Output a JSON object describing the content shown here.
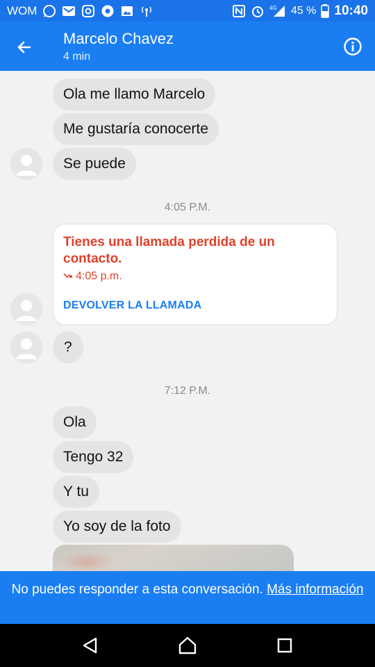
{
  "status_bar": {
    "carrier": "WOM",
    "network": "4G",
    "battery": "45 %",
    "time": "10:40",
    "left_icons": [
      "whatsapp-icon",
      "mail-icon",
      "instagram-icon",
      "chrome-icon",
      "gallery-icon",
      "signal-broadcast-icon"
    ],
    "right_icons": [
      "nfc-icon",
      "alarm-icon",
      "cell-signal-icon",
      "battery-icon"
    ]
  },
  "header": {
    "contact_name": "Marcelo Chavez",
    "subtitle": "4 min",
    "back_icon": "arrow-left-icon",
    "info_icon": "info-icon"
  },
  "thread": {
    "group1": [
      "Ola me llamo Marcelo",
      "Me gustaría conocerte",
      "Se puede"
    ],
    "timestamp1": "4:05 P.M.",
    "missed_call": {
      "title": "Tienes una llamada perdida de un contacto.",
      "time": "4:05 p.m.",
      "action": "DEVOLVER LA LLAMADA"
    },
    "question": "?",
    "timestamp2": "7:12 P.M.",
    "group2": [
      "Ola",
      "Tengo 32",
      "Y tu",
      "Yo soy de la foto"
    ]
  },
  "footer": {
    "message": "No puedes responder a esta conversación.",
    "link": "Más información"
  },
  "nav": {
    "back": "nav-back-icon",
    "home": "nav-home-icon",
    "recents": "nav-recents-icon"
  },
  "colors": {
    "status_bar": "#1a73e8",
    "header": "#1a7ef2",
    "bubble": "#e4e4e4",
    "missed_call_red": "#e0412b",
    "action_blue": "#1a7ef2",
    "background": "#f2f2f2"
  }
}
